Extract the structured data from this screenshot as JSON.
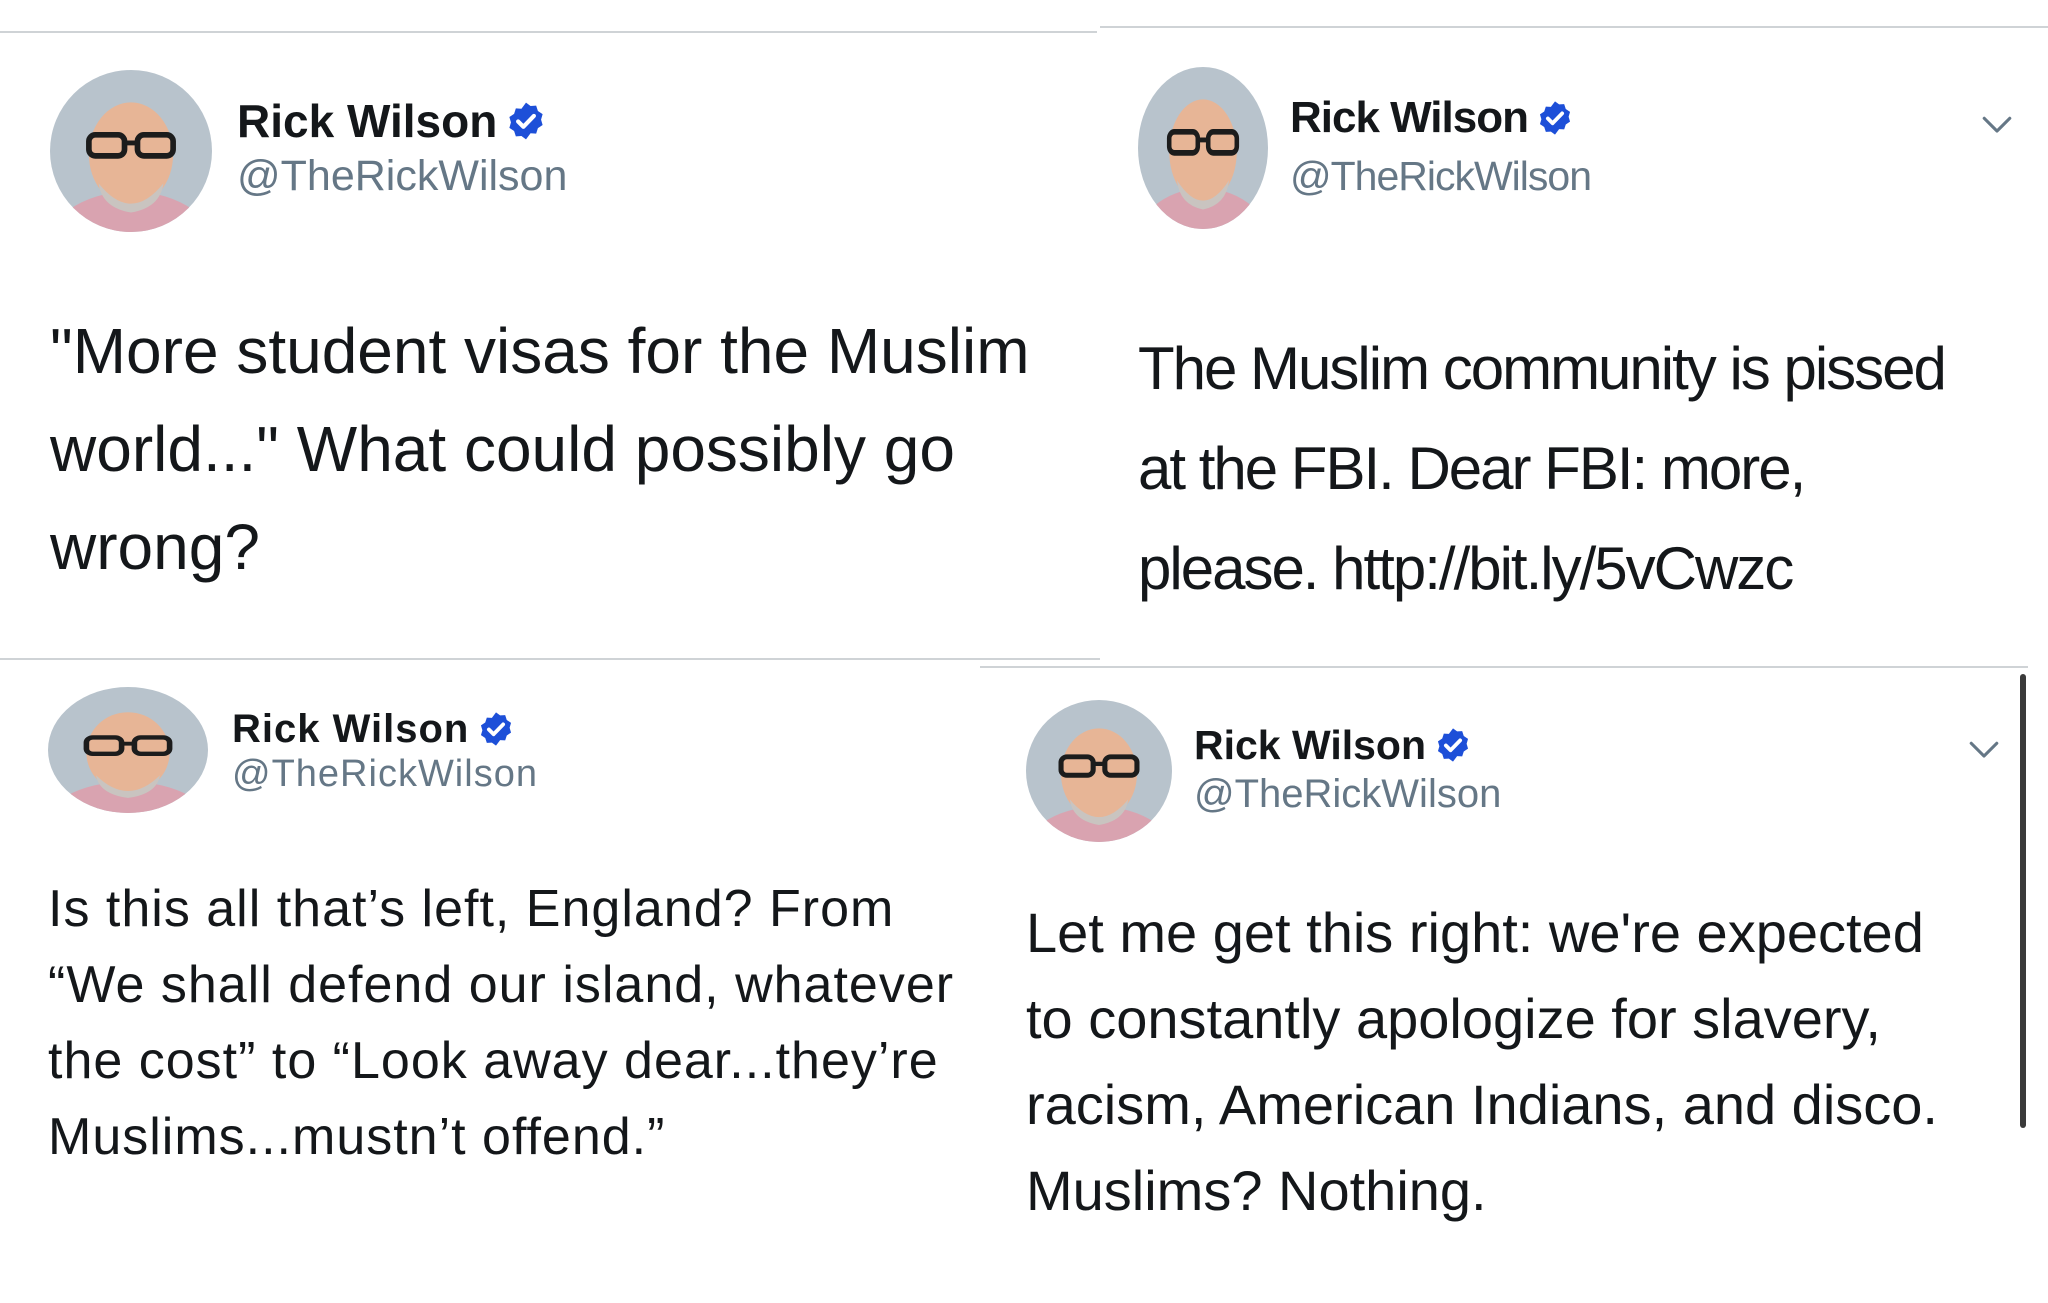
{
  "tweets": [
    {
      "author": {
        "name": "Rick Wilson",
        "handle": "@TheRickWilson",
        "verified": true,
        "avatar_icon": "avatar-photo"
      },
      "text": "\"More student visas for the Muslim world...\"  What could possibly go wrong?"
    },
    {
      "author": {
        "name": "Rick Wilson",
        "handle": "@TheRickWilson",
        "verified": true,
        "avatar_icon": "avatar-photo"
      },
      "text": "The Muslim community is pissed at the FBI.  Dear FBI: more, please. http://bit.ly/5vCwzc",
      "menu_icon": "chevron-down-icon"
    },
    {
      "author": {
        "name": "Rick Wilson",
        "handle": "@TheRickWilson",
        "verified": true,
        "avatar_icon": "avatar-photo"
      },
      "text": "Is this all that’s left, England? From “We shall defend our island, whatever the cost” to “Look away dear...they’re Muslims...mustn’t offend.”"
    },
    {
      "author": {
        "name": "Rick Wilson",
        "handle": "@TheRickWilson",
        "verified": true,
        "avatar_icon": "avatar-photo"
      },
      "text": "Let me get this right: we're expected to constantly apologize for slavery, racism, American Indians, and disco. Muslims? Nothing.",
      "menu_icon": "chevron-down-icon"
    }
  ],
  "colors": {
    "verified_badge": "#1d4fd8",
    "handle": "#657786",
    "text": "#14171a",
    "divider": "#cfd3d6"
  }
}
